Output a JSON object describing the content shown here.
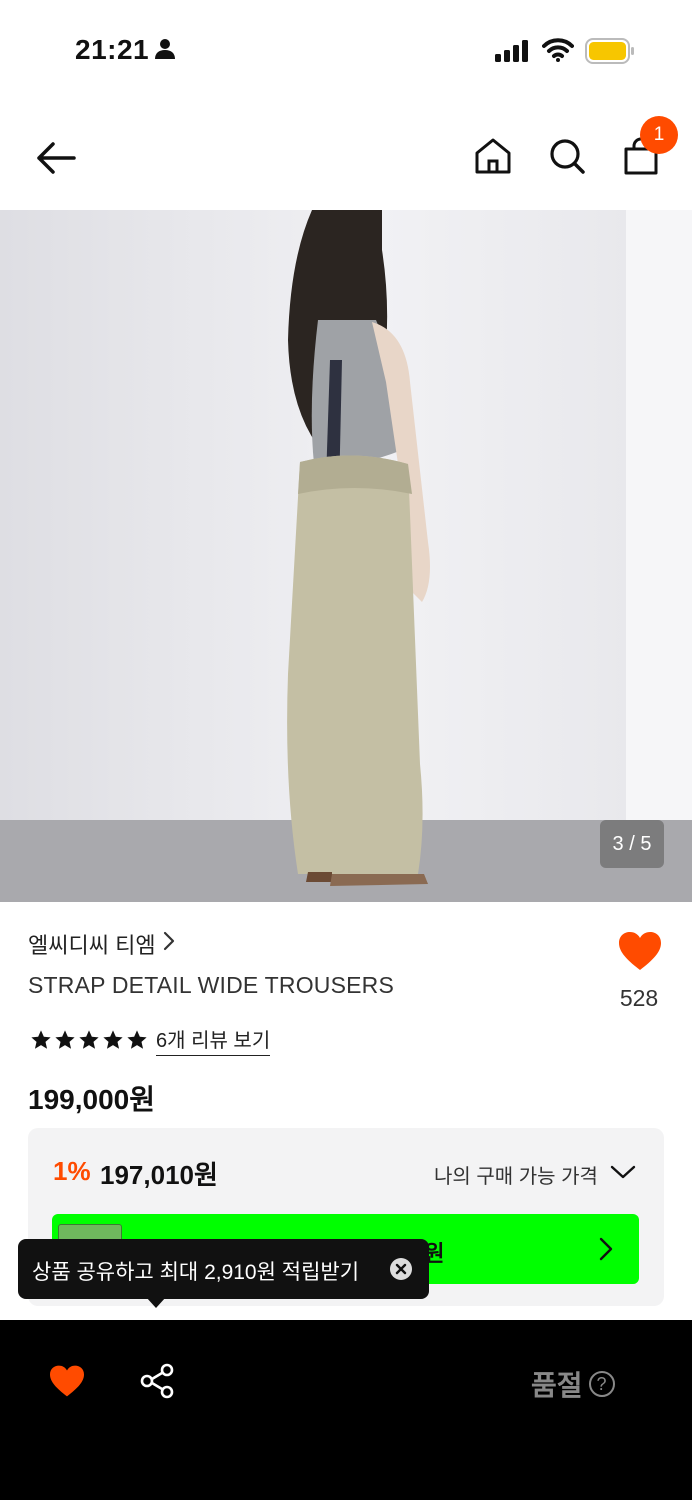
{
  "status_bar": {
    "time": "21:21"
  },
  "header": {
    "cart_count": "1"
  },
  "product": {
    "image_counter": "3 / 5",
    "brand": "엘씨디씨 티엠",
    "name": "STRAP DETAIL WIDE TROUSERS",
    "like_count": "528",
    "rating_stars": 5,
    "review_link": "6개 리뷰 보기",
    "price": "199,000원"
  },
  "discount": {
    "rate": "1%",
    "price": "197,010원",
    "my_price_label": "나의 구매 가능 가격",
    "banner_text": "0원"
  },
  "tooltip": {
    "text": "상품 공유하고 최대 2,910원 적립받기"
  },
  "bottom_bar": {
    "soldout_label": "품절",
    "help_symbol": "?"
  },
  "colors": {
    "accent": "#ff4b00",
    "promo_green": "#00ff00",
    "bar_bg": "#000000"
  }
}
